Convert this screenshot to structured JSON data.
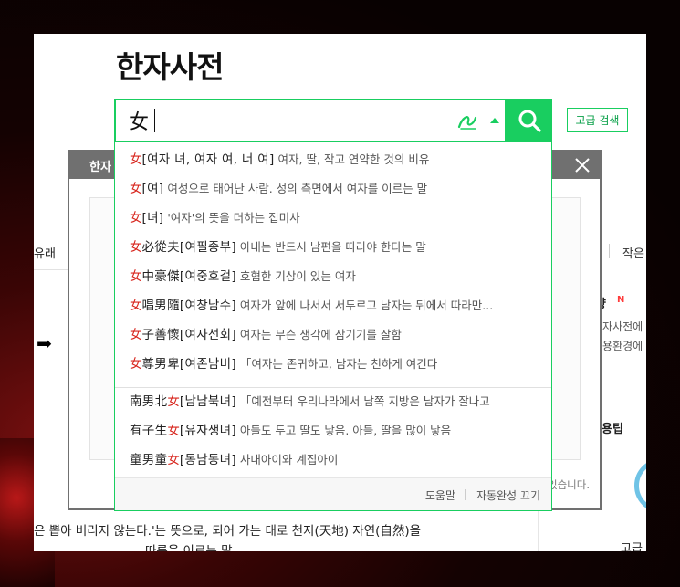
{
  "page": {
    "title": "한자사전"
  },
  "search": {
    "value": "女",
    "advanced_label": "고급 검색"
  },
  "background": {
    "left_label": "유래",
    "arrow": "➡",
    "sentence_line1": "은 뽑아 버리지 않는다.'는 뜻으로, 되어 가는 대로 천지(天地) 자연(自然)을",
    "sentence_line2": "따름을 이르는 말.",
    "right_small_label": "작은",
    "right_heading_1": "향",
    "new_badge": "N",
    "right_text_1": "한자사전에",
    "right_text_2": "사용환경에",
    "right_heading_2": "용팁",
    "right_bottom_label": "고급"
  },
  "modal": {
    "title": "한자",
    "note": "있습니다."
  },
  "autocomplete": {
    "items": [
      {
        "hanja": "女",
        "reading": "[여자 녀, 여자 여, 너 여]",
        "desc": "여자, 딸, 작고 연약한 것의 비유"
      },
      {
        "hanja": "女",
        "reading": "[여]",
        "desc": "여성으로 태어난 사람. 성의 측면에서 여자를 이르는 말"
      },
      {
        "hanja": "女",
        "reading": "[녀]",
        "desc": "'여자'의 뜻을 더하는 접미사"
      },
      {
        "hanja": "女",
        "rest": "必從夫",
        "reading": "[여필종부]",
        "desc": "아내는 반드시 남편을 따라야 한다는 말"
      },
      {
        "hanja": "女",
        "rest": "中豪傑",
        "reading": "[여중호걸]",
        "desc": "호협한 기상이 있는 여자"
      },
      {
        "hanja": "女",
        "rest": "唱男隨",
        "reading": "[여창남수]",
        "desc": "여자가 앞에 나서서 서두르고 남자는 뒤에서 따라만..."
      },
      {
        "hanja": "女",
        "rest": "子善懷",
        "reading": "[여자선회]",
        "desc": "여자는 무슨 생각에 잠기기를 잘함"
      },
      {
        "hanja": "女",
        "rest": "尊男卑",
        "reading": "[여존남비]",
        "desc": "「여자는 존귀하고, 남자는 천하게 여긴다"
      }
    ],
    "items2": [
      {
        "pre": "南男北",
        "hanja": "女",
        "reading": "[남남북녀]",
        "desc": "「예전부터 우리나라에서 남쪽 지방은 남자가 잘나고"
      },
      {
        "pre": "有子生",
        "hanja": "女",
        "reading": "[유자생녀]",
        "desc": "아들도 두고 딸도 낳음. 아들, 딸을 많이 낳음"
      },
      {
        "pre": "童男童",
        "hanja": "女",
        "reading": "[동남동녀]",
        "desc": "사내아이와 계집아이"
      }
    ],
    "help_label": "도움말",
    "off_label": "자동완성 끄기"
  },
  "colors": {
    "accent": "#19ce60",
    "highlight": "#d8261e"
  }
}
